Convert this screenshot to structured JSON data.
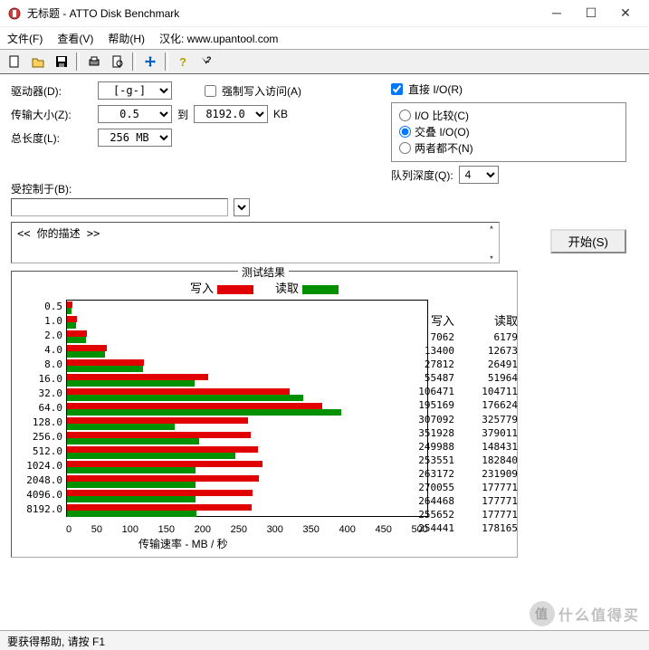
{
  "window": {
    "title": "无标题 - ATTO Disk Benchmark"
  },
  "menu": {
    "file": "文件(F)",
    "view": "查看(V)",
    "help": "帮助(H)",
    "han": "汉化: www.upantool.com"
  },
  "labels": {
    "drive": "驱动器(D):",
    "drive_val": "[-g-]",
    "force": "强制写入访问(A)",
    "xfer": "传输大小(Z):",
    "xfer_from": "0.5",
    "to": "到",
    "xfer_to": "8192.0",
    "kb": "KB",
    "totlen": "总长度(L):",
    "totlen_val": "256 MB",
    "direct": "直接 I/O(R)",
    "iocmp": "I/O 比较(C)",
    "overlap": "交叠 I/O(O)",
    "neither": "两者都不(N)",
    "qdepth": "队列深度(Q):",
    "qdepth_val": "4",
    "controlled": "受控制于(B):",
    "start": "开始(S)",
    "desc": "<<  你的描述   >>",
    "results": "测试结果",
    "write": "写入",
    "read": "读取",
    "xrate": "传输速率 - MB / 秒"
  },
  "status": "要获得帮助, 请按 F1",
  "watermark": "什么值得买",
  "watermark_icon": "值",
  "chart_data": {
    "type": "bar",
    "ylabel_categories": [
      "0.5",
      "1.0",
      "2.0",
      "4.0",
      "8.0",
      "16.0",
      "32.0",
      "64.0",
      "128.0",
      "256.0",
      "512.0",
      "1024.0",
      "2048.0",
      "4096.0",
      "8192.0"
    ],
    "xticks": [
      "0",
      "50",
      "100",
      "150",
      "200",
      "250",
      "300",
      "350",
      "400",
      "450",
      "500"
    ],
    "xlim": [
      0,
      500
    ],
    "xlabel": "传输速率 - MB / 秒",
    "series": [
      {
        "name": "写入",
        "color": "#e00000",
        "values": [
          7062,
          13400,
          27812,
          55487,
          106471,
          195169,
          307092,
          351928,
          249988,
          253551,
          263172,
          270055,
          264468,
          255652,
          254441
        ]
      },
      {
        "name": "读取",
        "color": "#009000",
        "values": [
          6179,
          12673,
          26491,
          51964,
          104711,
          176624,
          325779,
          379011,
          148431,
          182840,
          231909,
          177771,
          177771,
          177771,
          178165
        ]
      }
    ]
  }
}
